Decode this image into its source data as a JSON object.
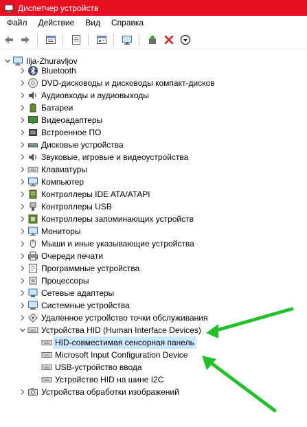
{
  "window": {
    "title": "Диспетчер устройств",
    "accent_color": "#e81123"
  },
  "menu": [
    "Файл",
    "Действие",
    "Вид",
    "Справка"
  ],
  "toolbar": {
    "icons": [
      "back-arrow-icon",
      "forward-arrow-icon",
      "properties-icon",
      "help-icon",
      "update-driver-icon",
      "scan-hardware-icon",
      "enable-device-icon",
      "uninstall-device-icon",
      "disable-device-icon"
    ]
  },
  "tree": {
    "root": "Ilja-Zhuravljov",
    "categories": [
      "Bluetooth",
      "DVD-дисководы и дисководы компакт-дисков",
      "Аудиовходы и аудиовыходы",
      "Батареи",
      "Видеоадаптеры",
      "Встроенное ПО",
      "Дисковые устройства",
      "Звуковые, игровые и видеоустройства",
      "Клавиатуры",
      "Компьютер",
      "Контроллеры IDE ATA/ATAPI",
      "Контроллеры USB",
      "Контроллеры запоминающих устройств",
      "Мониторы",
      "Мыши и иные указывающие устройства",
      "Очереди печати",
      "Программные устройства",
      "Процессоры",
      "Сетевые адаптеры",
      "Системные устройства",
      "Удаленное устройство точки обслуживания",
      "Устройства HID (Human Interface Devices)"
    ],
    "hid_children": [
      "HID-совместимая сенсорная панель",
      "Microsoft Input Configuration Device",
      "USB-устройство ввода",
      "Устройство HID на шине I2C"
    ],
    "last_category": "Устройства обработки изображений",
    "expanded_category": "Устройства HID (Human Interface Devices)",
    "selected_item": "HID-совместимая сенсорная панель"
  },
  "annotation_color": "#22c02a"
}
